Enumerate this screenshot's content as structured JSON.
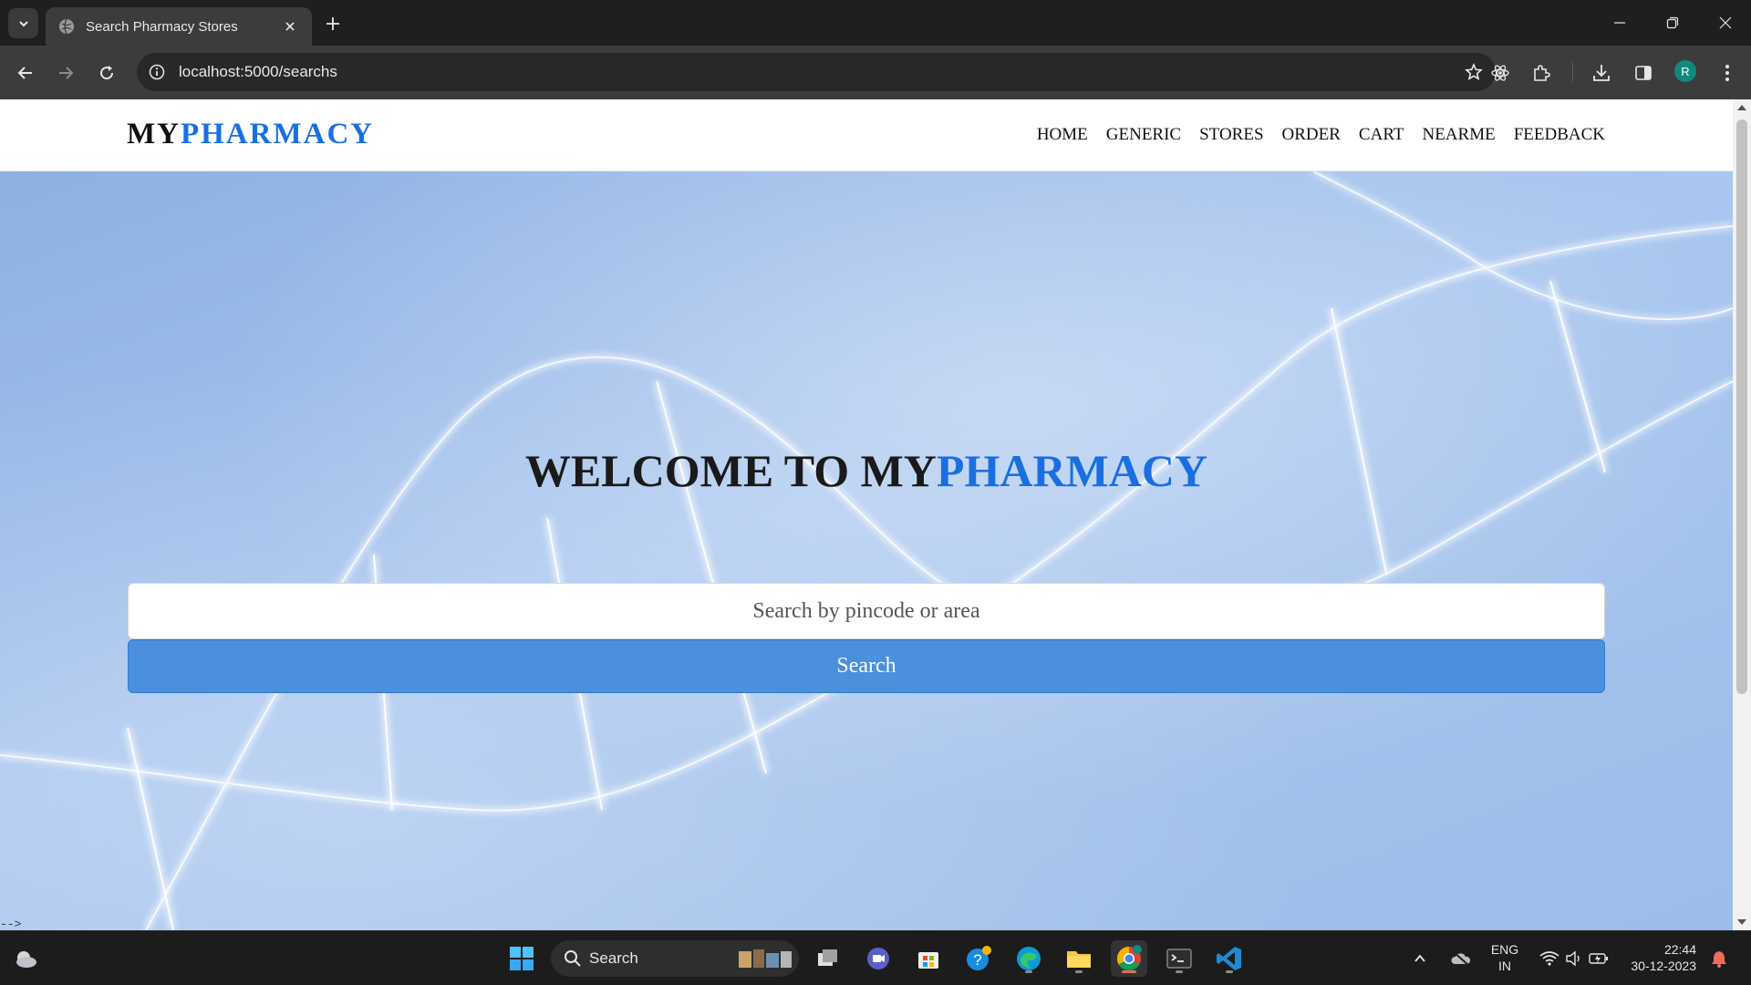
{
  "browser": {
    "tab_title": "Search Pharmacy Stores",
    "url": "localhost:5000/searchs",
    "profile_initial": "R"
  },
  "site": {
    "brand_part1": "MY",
    "brand_part2": "PHARMACY",
    "nav": [
      "HOME",
      "GENERIC",
      "STORES",
      "ORDER",
      "CART",
      "NEARME",
      "FEEDBACK"
    ],
    "welcome_part1": "WELCOME TO MY",
    "welcome_part2": "PHARMACY",
    "search_placeholder": "Search by pincode or area",
    "search_button": "Search",
    "stray_text": "-->",
    "accent_color": "#1a6fe0",
    "button_color": "#4a90dc"
  },
  "taskbar": {
    "search_label": "Search",
    "lang_line1": "ENG",
    "lang_line2": "IN",
    "time": "22:44",
    "date": "30-12-2023"
  }
}
